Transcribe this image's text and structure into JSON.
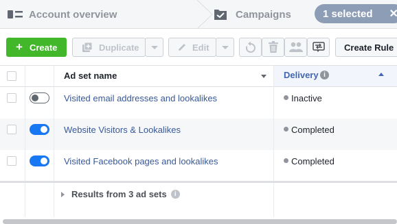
{
  "tabs": {
    "account_overview": "Account overview",
    "campaigns": "Campaigns",
    "selected_label": "1 selected"
  },
  "toolbar": {
    "create_label": "Create",
    "duplicate_label": "Duplicate",
    "edit_label": "Edit",
    "create_rule_label": "Create Rule"
  },
  "table": {
    "header_name": "Ad set name",
    "header_delivery": "Delivery",
    "rows": [
      {
        "name": "Visited email addresses and lookalikes",
        "delivery": "Inactive",
        "toggle_on": false
      },
      {
        "name": "Website Visitors & Lookalikes",
        "delivery": "Completed",
        "toggle_on": true
      },
      {
        "name": "Visited Facebook pages and lookalikes",
        "delivery": "Completed",
        "toggle_on": true
      }
    ],
    "results_label": "Results from 3 ad sets"
  },
  "colors": {
    "create_button": "#42b72a",
    "toggle_on": "#1877f2",
    "link": "#385898",
    "delivery_header": "#4267b2",
    "selected_pill": "#8d9db5"
  }
}
